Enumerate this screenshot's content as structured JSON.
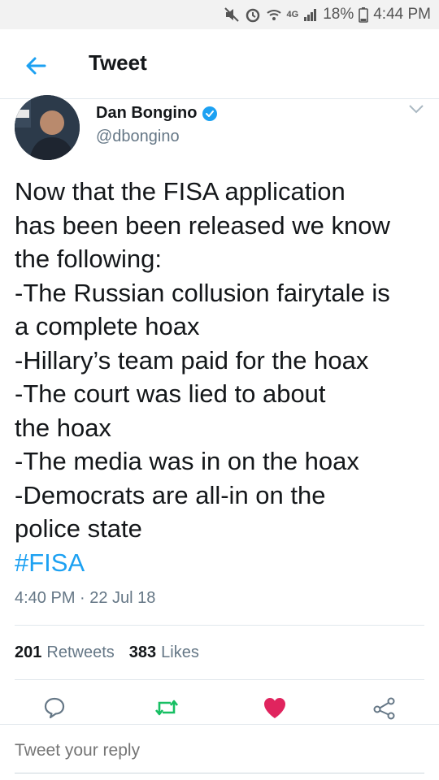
{
  "status_bar": {
    "icons": [
      "mute-icon",
      "alarm-icon",
      "wifi-icon",
      "network-4g-icon",
      "signal-icon",
      "battery-icon"
    ],
    "network_label": "4G",
    "battery": "18%",
    "time": "4:44 PM"
  },
  "header": {
    "title": "Tweet",
    "back_icon": "back-arrow-icon"
  },
  "author": {
    "name": "Dan Bongino",
    "handle": "@dbongino",
    "verified": true,
    "avatar_icon": "avatar-photo"
  },
  "tweet": {
    "lines": [
      "Now that the FISA application",
      "has been been released we know",
      "the following:",
      "-The Russian collusion fairytale is",
      "a complete hoax",
      "-Hillary’s team paid for the hoax",
      "-The court was lied to about",
      "the hoax",
      "-The media was in on the hoax",
      "-Democrats are all-in on the",
      "police state"
    ],
    "hashtag": "#FISA",
    "timestamp": "4:40 PM · 22 Jul 18"
  },
  "stats": {
    "retweets_count": "201",
    "retweets_label": "Retweets",
    "likes_count": "383",
    "likes_label": "Likes"
  },
  "actions": {
    "reply_icon": "reply-icon",
    "retweet_icon": "retweet-icon",
    "like_icon": "heart-icon",
    "share_icon": "share-icon"
  },
  "colors": {
    "accent": "#1da1f2",
    "retweet_green": "#17bf63",
    "like_red": "#e0245e",
    "secondary_text": "#657786"
  },
  "reply": {
    "placeholder": "Tweet your reply"
  }
}
